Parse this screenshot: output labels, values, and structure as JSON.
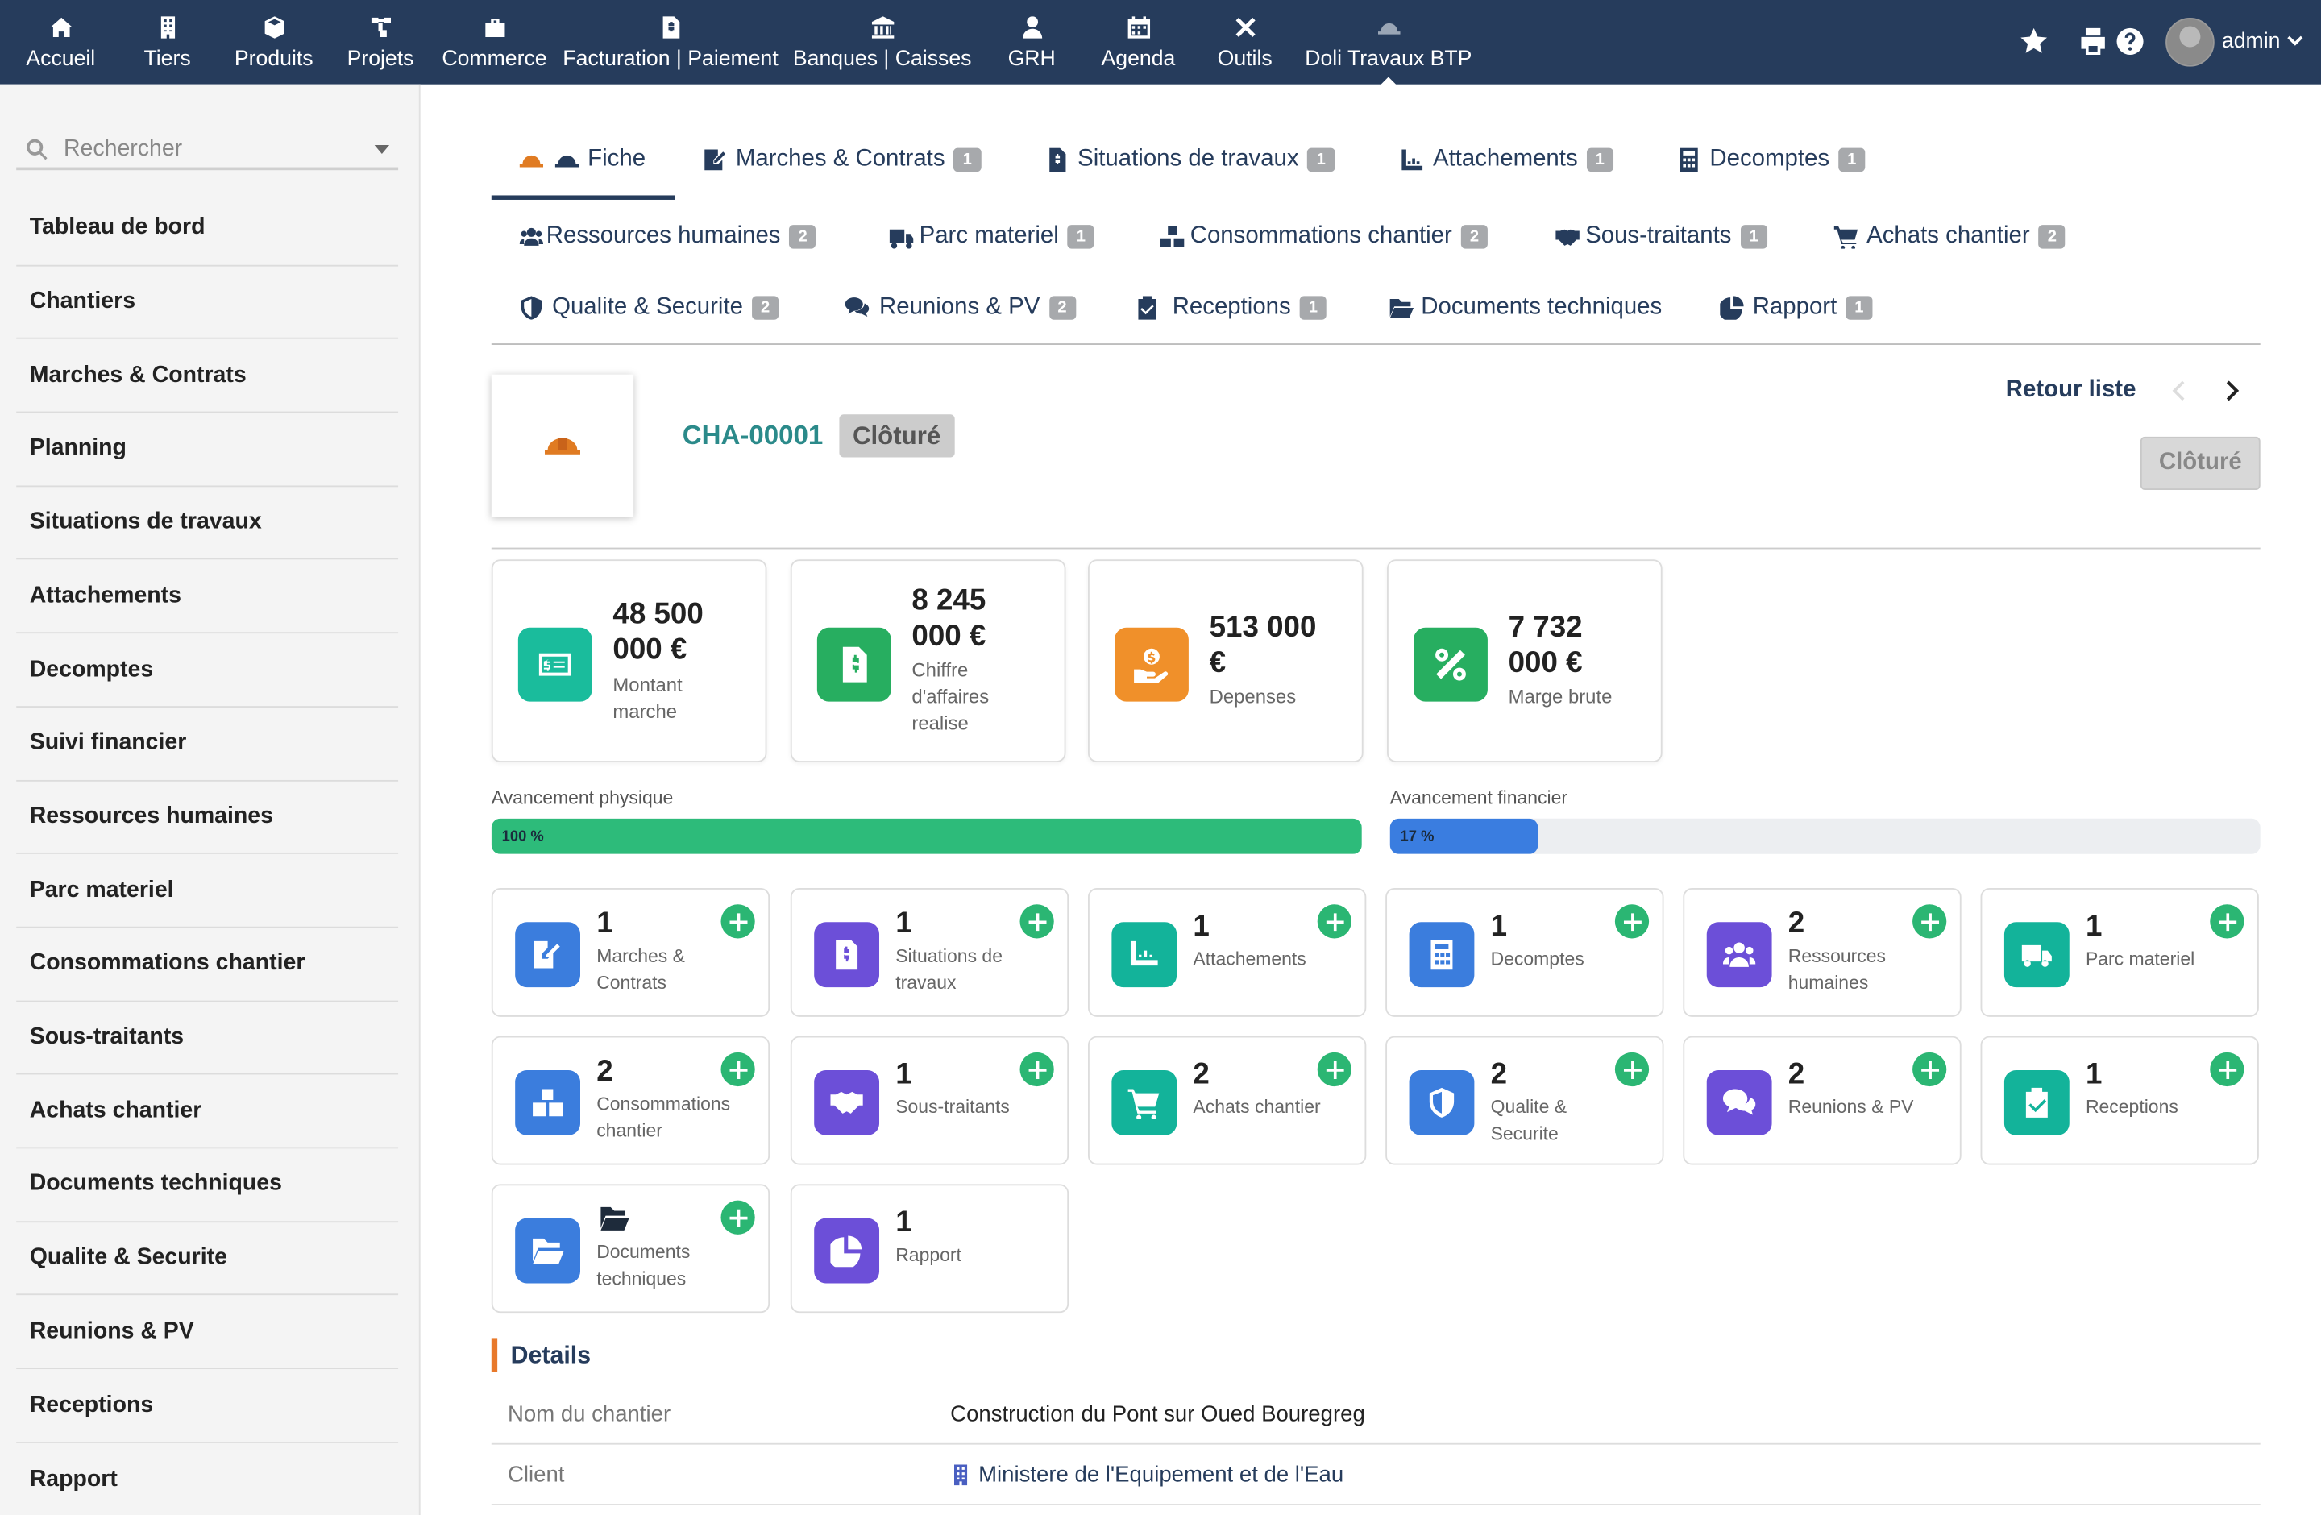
{
  "topbar": {
    "nav": [
      {
        "label": "Accueil",
        "icon": "home-icon"
      },
      {
        "label": "Tiers",
        "icon": "building-icon"
      },
      {
        "label": "Produits",
        "icon": "cube-icon"
      },
      {
        "label": "Projets",
        "icon": "sitemap-icon"
      },
      {
        "label": "Commerce",
        "icon": "briefcase-icon"
      },
      {
        "label": "Facturation | Paiement",
        "icon": "invoice-icon"
      },
      {
        "label": "Banques | Caisses",
        "icon": "bank-icon"
      },
      {
        "label": "GRH",
        "icon": "user-tie-icon"
      },
      {
        "label": "Agenda",
        "icon": "calendar-icon"
      },
      {
        "label": "Outils",
        "icon": "tools-icon"
      },
      {
        "label": "Doli Travaux BTP",
        "icon": "hard-hat-icon"
      }
    ],
    "user": "admin"
  },
  "sidebar": {
    "search_placeholder": "Rechercher",
    "items": [
      "Tableau de bord",
      "Chantiers",
      "Marches & Contrats",
      "Planning",
      "Situations de travaux",
      "Attachements",
      "Decomptes",
      "Suivi financier",
      "Ressources humaines",
      "Parc materiel",
      "Consommations chantier",
      "Sous-traitants",
      "Achats chantier",
      "Documents techniques",
      "Qualite & Securite",
      "Reunions & PV",
      "Receptions",
      "Rapport"
    ]
  },
  "tabs": [
    {
      "label": "Fiche",
      "badge": ""
    },
    {
      "label": "Marches & Contrats",
      "badge": "1"
    },
    {
      "label": "Situations de travaux",
      "badge": "1"
    },
    {
      "label": "Attachements",
      "badge": "1"
    },
    {
      "label": "Decomptes",
      "badge": "1"
    },
    {
      "label": "Ressources humaines",
      "badge": "2"
    },
    {
      "label": "Parc materiel",
      "badge": "1"
    },
    {
      "label": "Consommations chantier",
      "badge": "2"
    },
    {
      "label": "Sous-traitants",
      "badge": "1"
    },
    {
      "label": "Achats chantier",
      "badge": "2"
    },
    {
      "label": "Qualite & Securite",
      "badge": "2"
    },
    {
      "label": "Reunions & PV",
      "badge": "2"
    },
    {
      "label": "Receptions",
      "badge": "1"
    },
    {
      "label": "Documents techniques",
      "badge": ""
    },
    {
      "label": "Rapport",
      "badge": "1"
    }
  ],
  "header": {
    "ref": "CHA-00001",
    "status": "Clôturé",
    "back_link": "Retour liste",
    "status_button": "Clôturé"
  },
  "kpis": [
    {
      "value_l1": "48 500",
      "value_l2": "000 €",
      "label_lines": [
        "Montant",
        "marche"
      ],
      "color": "#1abc9c"
    },
    {
      "value_l1": "8 245",
      "value_l2": "000 €",
      "label_lines": [
        "Chiffre",
        "d'affaires",
        "realise"
      ],
      "color": "#27ae60"
    },
    {
      "value_l1": "513 000",
      "value_l2": "€",
      "label_lines": [
        "Depenses"
      ],
      "color": "#f0902a"
    },
    {
      "value_l1": "7 732",
      "value_l2": "000 €",
      "label_lines": [
        "Marge brute"
      ],
      "color": "#27ae60"
    }
  ],
  "progress": {
    "physical": {
      "label": "Avancement physique",
      "text": "100 %",
      "value": 1.0,
      "color": "#2dbb7a"
    },
    "financial": {
      "label": "Avancement financier",
      "text": "17 %",
      "value": 0.17,
      "color": "#3a7de0"
    }
  },
  "cards": [
    {
      "count": "1",
      "label_lines": [
        "Marches &",
        "Contrats"
      ],
      "color": "#3b7ddd",
      "icon": "contract-icon",
      "add": true
    },
    {
      "count": "1",
      "label_lines": [
        "Situations de",
        "travaux"
      ],
      "color": "#6c4fd8",
      "icon": "invoice-dollar-icon",
      "add": true
    },
    {
      "count": "1",
      "label_lines": [
        "Attachements"
      ],
      "color": "#13b39a",
      "icon": "ruler-icon",
      "add": true
    },
    {
      "count": "1",
      "label_lines": [
        "Decomptes"
      ],
      "color": "#3b7ddd",
      "icon": "calculator-icon",
      "add": true
    },
    {
      "count": "2",
      "label_lines": [
        "Ressources",
        "humaines"
      ],
      "color": "#6c4fd8",
      "icon": "users-icon",
      "add": true
    },
    {
      "count": "1",
      "label_lines": [
        "Parc materiel"
      ],
      "color": "#13b39a",
      "icon": "truck-icon",
      "add": true
    },
    {
      "count": "2",
      "label_lines": [
        "Consommations",
        "chantier"
      ],
      "color": "#3b7ddd",
      "icon": "boxes-icon",
      "add": true
    },
    {
      "count": "1",
      "label_lines": [
        "Sous-traitants"
      ],
      "color": "#6c4fd8",
      "icon": "handshake-icon",
      "add": true
    },
    {
      "count": "2",
      "label_lines": [
        "Achats chantier"
      ],
      "color": "#13b39a",
      "icon": "cart-icon",
      "add": true
    },
    {
      "count": "2",
      "label_lines": [
        "Qualite & Securite"
      ],
      "color": "#3b7ddd",
      "icon": "shield-icon",
      "add": true
    },
    {
      "count": "2",
      "label_lines": [
        "Reunions & PV"
      ],
      "color": "#6c4fd8",
      "icon": "comments-icon",
      "add": true
    },
    {
      "count": "1",
      "label_lines": [
        "Receptions"
      ],
      "color": "#13b39a",
      "icon": "clipboard-check-icon",
      "add": true
    },
    {
      "count": "",
      "label_lines": [
        "Documents",
        "techniques"
      ],
      "color": "#3b7ddd",
      "icon": "folder-open-icon",
      "add": true
    },
    {
      "count": "1",
      "label_lines": [
        "Rapport"
      ],
      "color": "#6c4fd8",
      "icon": "chart-pie-icon",
      "add": false
    }
  ],
  "details": {
    "title": "Details",
    "rows": [
      {
        "key": "Nom du chantier",
        "value": "Construction du Pont sur Oued Bouregreg"
      },
      {
        "key": "Client",
        "value": "Ministere de l'Equipement et de l'Eau"
      }
    ]
  }
}
